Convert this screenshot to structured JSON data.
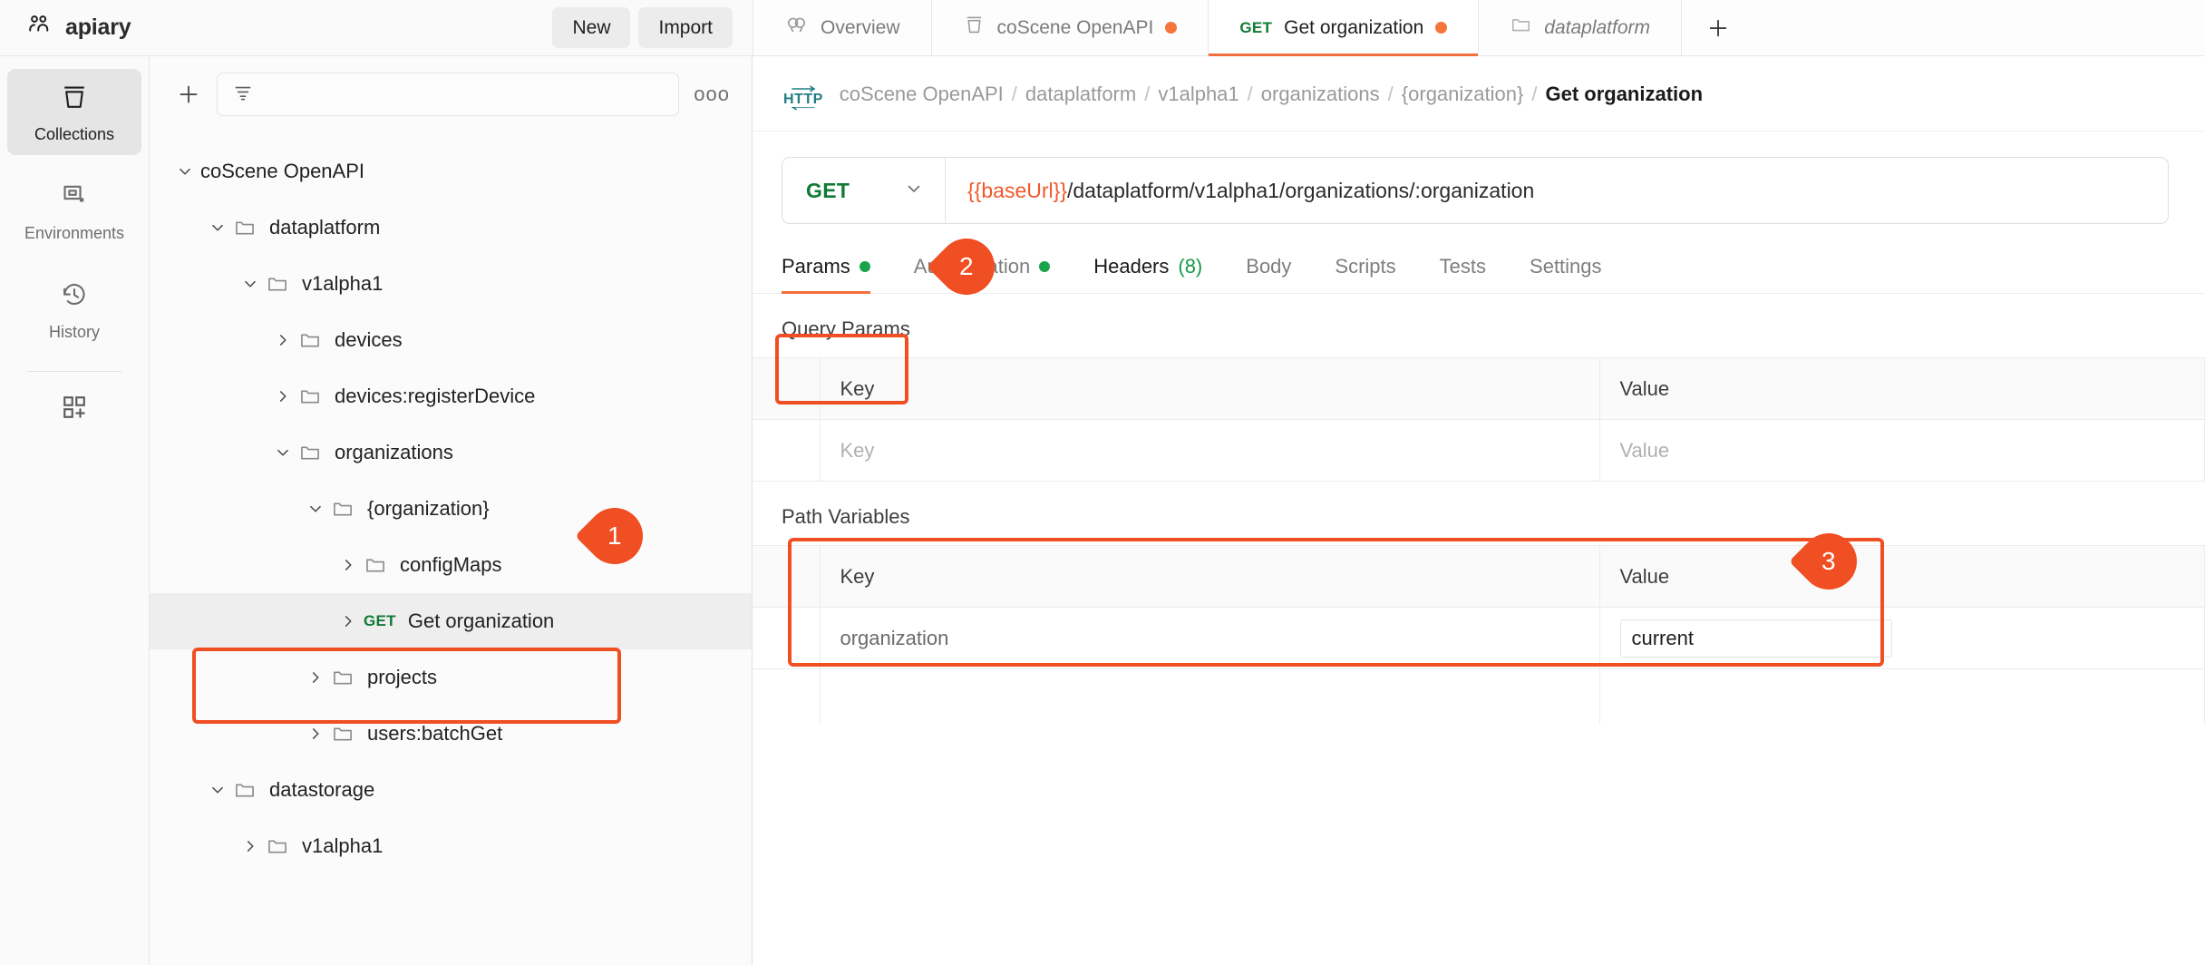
{
  "header": {
    "workspace_name": "apiary",
    "workspace_icon": "users-icon",
    "new_label": "New",
    "import_label": "Import"
  },
  "tabs": [
    {
      "label": "Overview",
      "icon": "overview-icon",
      "method": "",
      "dirty": false,
      "active": false,
      "italic": false
    },
    {
      "label": "coScene OpenAPI",
      "icon": "collection-icon",
      "method": "",
      "dirty": true,
      "active": false,
      "italic": false
    },
    {
      "label": "Get organization",
      "icon": "",
      "method": "GET",
      "dirty": true,
      "active": true,
      "italic": false
    },
    {
      "label": "dataplatform",
      "icon": "folder-icon",
      "method": "",
      "dirty": false,
      "active": false,
      "italic": true
    }
  ],
  "tab_add_label": "+",
  "rail": {
    "items": [
      {
        "label": "Collections",
        "icon": "collections-icon",
        "active": true
      },
      {
        "label": "Environments",
        "icon": "environments-icon",
        "active": false
      },
      {
        "label": "History",
        "icon": "history-icon",
        "active": false
      }
    ],
    "add_icon": "add-apps-icon"
  },
  "sidebar": {
    "add_icon": "plus-icon",
    "filter_icon": "filter-icon",
    "filter_placeholder": "",
    "more_icon": "more-options-icon",
    "tree": [
      {
        "label": "coScene OpenAPI",
        "depth": 0,
        "expanded": true,
        "type": "collection",
        "method": "",
        "selected": false
      },
      {
        "label": "dataplatform",
        "depth": 1,
        "expanded": true,
        "type": "folder",
        "method": "",
        "selected": false
      },
      {
        "label": "v1alpha1",
        "depth": 2,
        "expanded": true,
        "type": "folder",
        "method": "",
        "selected": false
      },
      {
        "label": "devices",
        "depth": 3,
        "expanded": false,
        "type": "folder",
        "method": "",
        "selected": false
      },
      {
        "label": "devices:registerDevice",
        "depth": 3,
        "expanded": false,
        "type": "folder",
        "method": "",
        "selected": false
      },
      {
        "label": "organizations",
        "depth": 3,
        "expanded": true,
        "type": "folder",
        "method": "",
        "selected": false
      },
      {
        "label": "{organization}",
        "depth": 4,
        "expanded": true,
        "type": "folder",
        "method": "",
        "selected": false
      },
      {
        "label": "configMaps",
        "depth": 5,
        "expanded": false,
        "type": "folder",
        "method": "",
        "selected": false
      },
      {
        "label": "Get organization",
        "depth": 5,
        "expanded": false,
        "type": "request",
        "method": "GET",
        "selected": true
      },
      {
        "label": "projects",
        "depth": 4,
        "expanded": false,
        "type": "folder",
        "method": "",
        "selected": false
      },
      {
        "label": "users:batchGet",
        "depth": 4,
        "expanded": false,
        "type": "folder",
        "method": "",
        "selected": false
      },
      {
        "label": "datastorage",
        "depth": 1,
        "expanded": true,
        "type": "folder",
        "method": "",
        "selected": false
      },
      {
        "label": "v1alpha1",
        "depth": 2,
        "expanded": false,
        "type": "folder",
        "method": "",
        "selected": false
      }
    ]
  },
  "request": {
    "protocol_badge": "HTTP",
    "breadcrumb": [
      "coScene OpenAPI",
      "dataplatform",
      "v1alpha1",
      "organizations",
      "{organization}"
    ],
    "breadcrumb_current": "Get organization",
    "method": "GET",
    "method_chevron": "chevron-down-icon",
    "url_variable": "{{baseUrl}}",
    "url_path": "/dataplatform/v1alpha1/organizations/:organization",
    "tabs": [
      {
        "label": "Params",
        "dot": true,
        "count": "",
        "active": true,
        "strong": true
      },
      {
        "label": "Authorization",
        "dot": true,
        "count": "",
        "active": false,
        "strong": false
      },
      {
        "label": "Headers",
        "dot": false,
        "count": "(8)",
        "active": false,
        "strong": true
      },
      {
        "label": "Body",
        "dot": false,
        "count": "",
        "active": false,
        "strong": false
      },
      {
        "label": "Scripts",
        "dot": false,
        "count": "",
        "active": false,
        "strong": false
      },
      {
        "label": "Tests",
        "dot": false,
        "count": "",
        "active": false,
        "strong": false
      },
      {
        "label": "Settings",
        "dot": false,
        "count": "",
        "active": false,
        "strong": false
      }
    ],
    "query_params": {
      "title": "Query Params",
      "columns": [
        "Key",
        "Value"
      ],
      "rows": [
        {
          "key": "",
          "key_placeholder": "Key",
          "value": "",
          "value_placeholder": "Value"
        }
      ]
    },
    "path_variables": {
      "title": "Path Variables",
      "columns": [
        "Key",
        "Value"
      ],
      "rows": [
        {
          "key": "organization",
          "key_placeholder": "",
          "value": "current",
          "value_placeholder": ""
        }
      ]
    }
  },
  "annotations": [
    {
      "number": "1",
      "target": "sidebar-request-get-organization"
    },
    {
      "number": "2",
      "target": "request-tab-params"
    },
    {
      "number": "3",
      "target": "path-variables-table"
    }
  ],
  "colors": {
    "accent": "#f26e3f",
    "annotation": "#f04e23",
    "method_get": "#0f7b34",
    "dot_green": "#1aa34a",
    "dot_orange": "#f5753b",
    "url_variable": "#f2582a",
    "http_badge": "#1f7e84"
  }
}
